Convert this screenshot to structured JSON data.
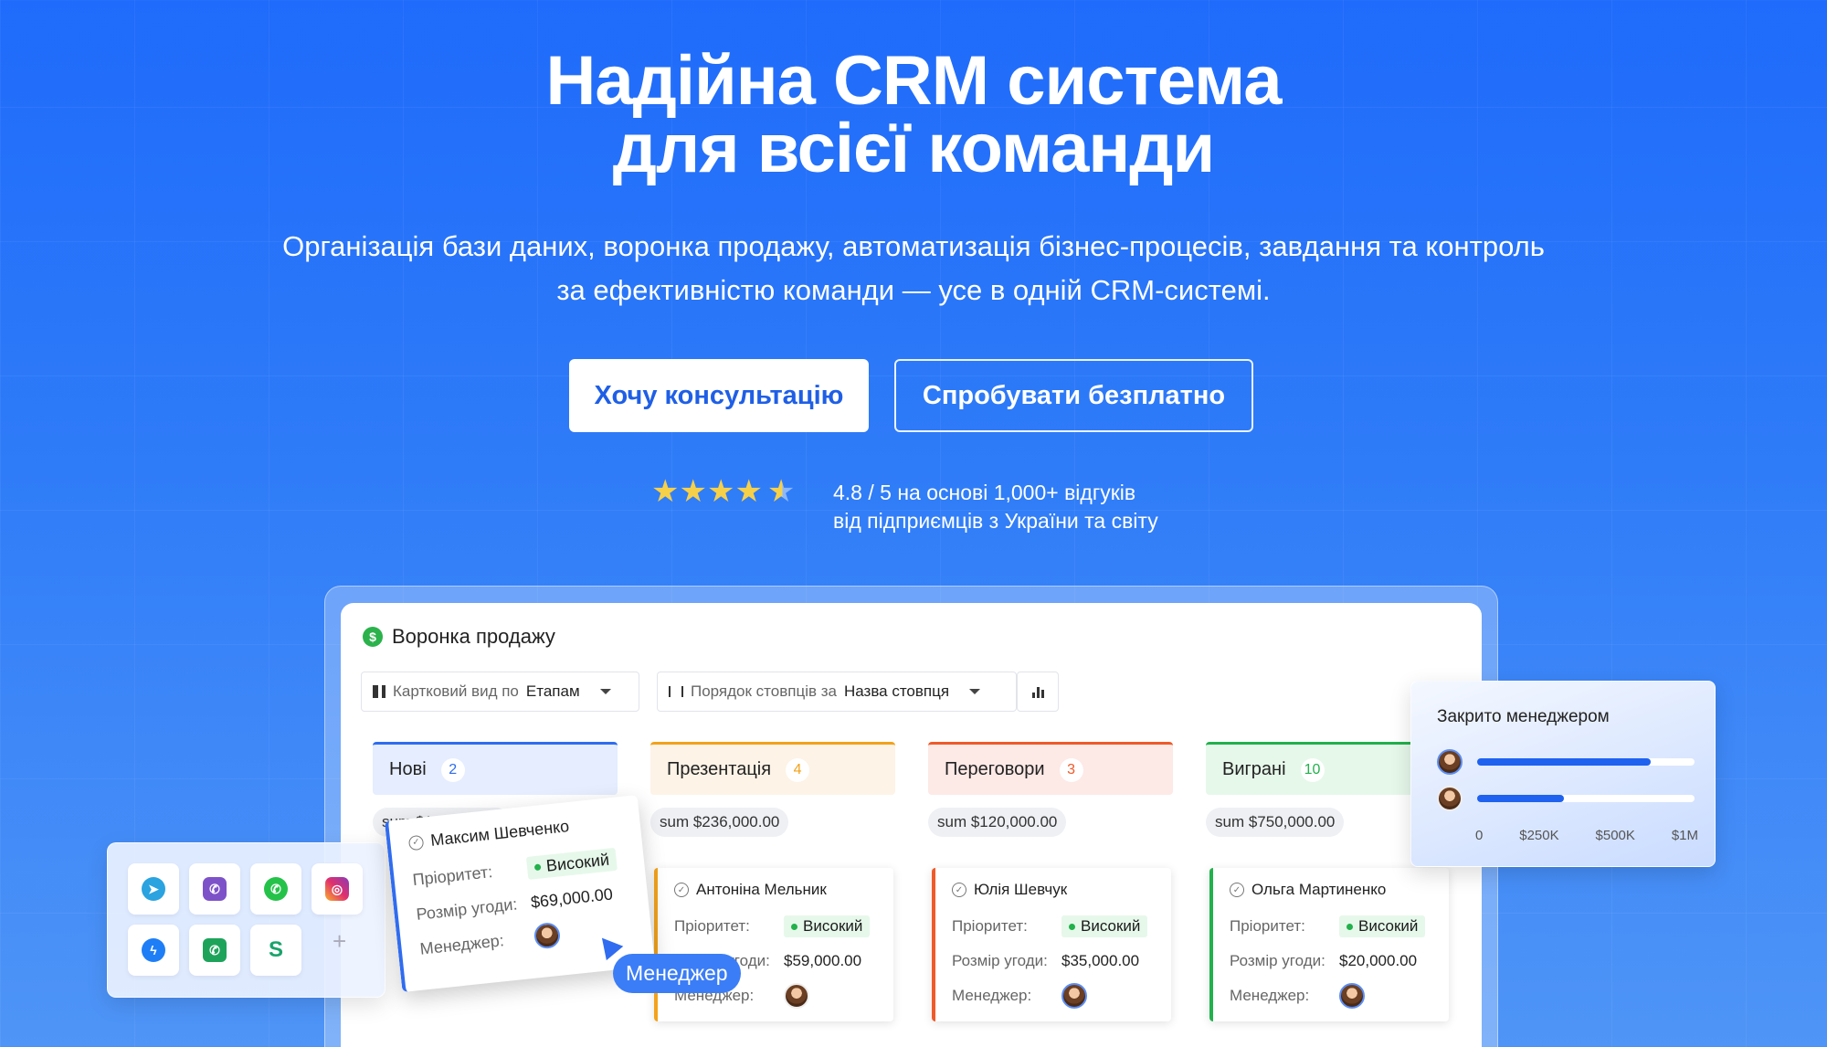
{
  "hero": {
    "title_line1": "Надійна CRM система",
    "title_line2": "для всієї команди",
    "subtitle_line1": "Організація бази даних, воронка продажу, автоматизація бізнес-процесів, завдання та контроль",
    "subtitle_line2": "за ефективністю команди — усе в одній CRM-системі.",
    "btn_primary": "Хочу консультацію",
    "btn_secondary": "Спробувати безплатно",
    "rating": {
      "value": 4.8,
      "stars": "★★★★",
      "half_star": "★",
      "line1": "4.8 / 5 на основі 1,000+ відгуків",
      "line2": "від підприємців з України та світу",
      "star_color": "#f7d049"
    }
  },
  "crm": {
    "title": "Воронка продажу",
    "view_label": "Картковий вид по",
    "view_value": "Етапам",
    "order_label": "Порядок стовпців за",
    "order_value": "Назва стовпця",
    "labels": {
      "priority": "Пріоритет:",
      "deal": "Розмір угоди:",
      "manager": "Менеджер:"
    },
    "columns": [
      {
        "name": "Нові",
        "count": "2",
        "sum": "sum $141,000.00",
        "color": "#2f6cf0",
        "bg": "#e5edff"
      },
      {
        "name": "Презентація",
        "count": "4",
        "sum": "sum $236,000.00",
        "color": "#f3a21b",
        "bg": "#fdf3e6",
        "card": {
          "name": "Антоніна Мельник",
          "priority": "Високий",
          "deal": "$59,000.00"
        }
      },
      {
        "name": "Переговори",
        "count": "3",
        "sum": "sum $120,000.00",
        "color": "#ef5a2a",
        "bg": "#fde9e6",
        "card": {
          "name": "Юлія Шевчук",
          "priority": "Високий",
          "deal": "$35,000.00"
        }
      },
      {
        "name": "Виграні",
        "count": "10",
        "sum": "sum $750,000.00",
        "color": "#22b14c",
        "bg": "#e6f8ea",
        "card": {
          "name": "Ольга Мартиненко",
          "priority": "Високий",
          "deal": "$20,000.00"
        }
      }
    ],
    "floating_card": {
      "name": "Максим Шевченко",
      "priority": "Високий",
      "deal": "$69,000.00"
    },
    "manager_pill": "Менеджер",
    "stats": {
      "title": "Закрито менеджером",
      "bars": [
        0.8,
        0.4
      ],
      "axis": [
        "0",
        "$250K",
        "$500K",
        "$1M"
      ]
    },
    "social_icons": [
      "telegram-icon",
      "viber-icon",
      "whatsapp-icon",
      "instagram-icon",
      "messenger-icon",
      "phone-icon",
      "s-icon",
      "plus-icon"
    ],
    "social_plus": "+"
  }
}
